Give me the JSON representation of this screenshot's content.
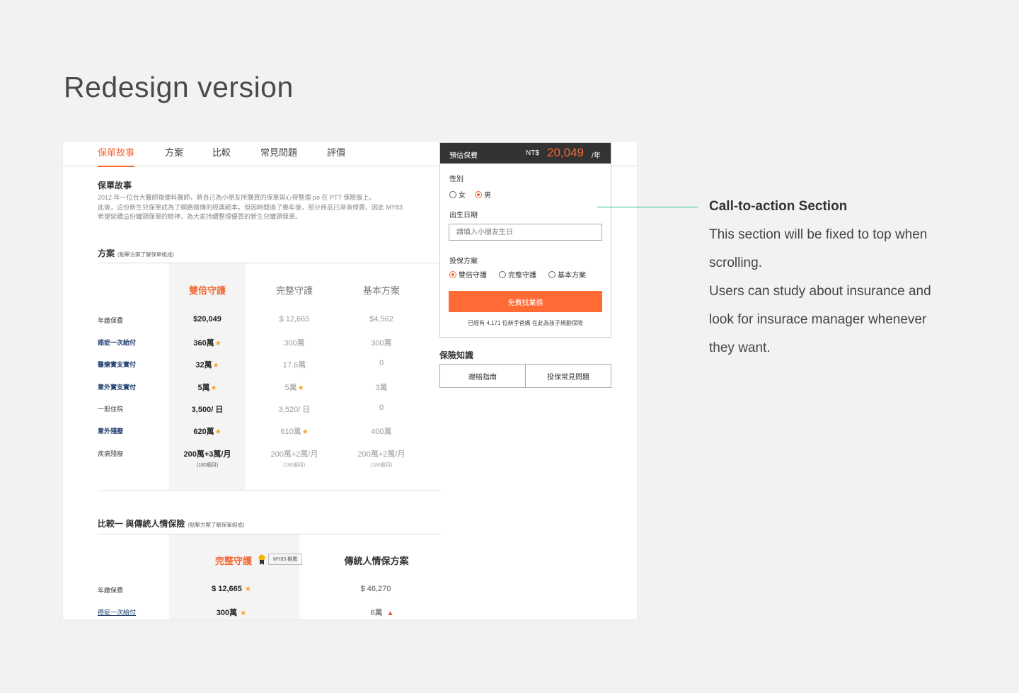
{
  "page_title": "Redesign version",
  "tabs": [
    "保單故事",
    "方案",
    "比較",
    "常見問題",
    "評價"
  ],
  "story": {
    "title": "保單故事",
    "lines": [
      "2012 年一位台大醫師復健科醫師，將自己為小朋友所購買的保單與心得整理 po 在 PTT 保險版上。",
      "此後，這份新生兒保單成為了網路瘋傳的經典範本。但因時間過了幾年後，部分商品已漸漸停賣，因此 MY83",
      "希望延續這份罐頭保單的精神，為大家持續整理優質的新生兒罐頭保單。"
    ]
  },
  "plans": {
    "title": "方案",
    "hint": "(點擊方案了解保單組成)",
    "columns": [
      "雙倍守護",
      "完整守護",
      "基本方案"
    ],
    "rows": [
      {
        "label": "年繳保費",
        "values": [
          "$20,049",
          "$ 12,665",
          "$4,562"
        ]
      },
      {
        "label": "癌症一次給付",
        "values": [
          "360萬",
          "300萬",
          "300萬"
        ]
      },
      {
        "label": "醫療實支實付",
        "values": [
          "32萬",
          "17.6萬",
          "0"
        ]
      },
      {
        "label": "意外實支實付",
        "values": [
          "5萬",
          "5萬",
          "3萬"
        ]
      },
      {
        "label": "一般住院",
        "values": [
          "3,500/ 日",
          "3,520/ 日",
          "0"
        ]
      },
      {
        "label": "意外殘廢",
        "values": [
          "620萬",
          "610萬",
          "400萬"
        ]
      },
      {
        "label": "疾病殘廢",
        "values": [
          "200萬+3萬/月",
          "200萬+2萬/月",
          "200萬+2萬/月"
        ],
        "subs": [
          "(180個月)",
          "(180個月)",
          "(180個月)"
        ]
      }
    ]
  },
  "compare": {
    "title": "比較一 與傳統人情保險",
    "hint": "(點擊方案了解保單組成)",
    "columns": [
      "完整守護",
      "傳統人情保方案"
    ],
    "badge": "MY83 推薦",
    "rows": [
      {
        "label": "年繳保費",
        "values": [
          "$ 12,665",
          "$ 46,270"
        ]
      },
      {
        "label": "癌症一次給付",
        "values": [
          "300萬",
          "6萬"
        ]
      }
    ]
  },
  "cta": {
    "header_label": "預估保費",
    "currency": "NT$",
    "amount": "20,049",
    "per": "/年",
    "gender_label": "性別",
    "gender_options": [
      "女",
      "男"
    ],
    "gender_selected": "男",
    "birth_label": "出生日期",
    "birth_placeholder": "請填入小朋友生日",
    "plan_label": "投保方案",
    "plan_options": [
      "雙倍守護",
      "完整守護",
      "基本方案"
    ],
    "plan_selected": "雙倍守護",
    "button": "免費找業務",
    "note": "已經有 4,171 位新手爸媽 在此為孩子規劃保險"
  },
  "knowledge": {
    "title": "保險知識",
    "buttons": [
      "理賠指南",
      "投保常見問題"
    ]
  },
  "callout": {
    "title": "Call-to-action Section",
    "lines": [
      "This section will be fixed to top when",
      "scrolling.",
      "Users can study about insurance and",
      "look for insurace manager whenever",
      "they want."
    ]
  },
  "colors": {
    "accent": "#f26a38",
    "cta_button": "#ff6a35",
    "navy": "#213e6e",
    "callout_line": "#2bbf94",
    "star": "#f5a623"
  }
}
